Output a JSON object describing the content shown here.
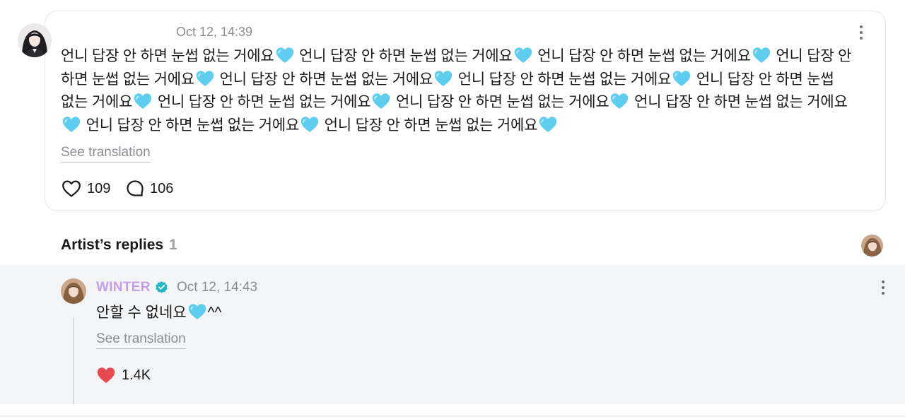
{
  "post": {
    "author_avatar_icon": "fan-avatar",
    "timestamp": "Oct 12, 14:39",
    "segments": [
      "언니 답장 안 하면 눈썹 없는 거에요",
      " 언니 답장 안 하면 눈썹 없는 거에요",
      " 언니 답장 안 하면 눈썹 없는 거에요",
      " 언니 답장 안 하면 눈썹 없는 거에요",
      " 언니 답장 안 하면 눈썹 없는 거에요",
      " 언니 답장 안 하면 눈썹 없는 거에요",
      " 언니 답장 안 하면 눈썹 없는 거에요",
      " 언니 답장 안 하면 눈썹 없는 거에요",
      " 언니 답장 안 하면 눈썹 없는 거에요",
      " 언니 답장 안 하면 눈썹 없는 거에요",
      " 언니 답장 안 하면 눈썹 없는 거에요",
      " 언니 답장 안 하면 눈썹 없는 거에요"
    ],
    "emoji_icon": "light-blue-heart-icon",
    "see_translation": "See translation",
    "like_count": "109",
    "comment_count": "106",
    "more_icon": "more-vertical-icon"
  },
  "artist_replies": {
    "title": "Artist’s replies",
    "count": "1",
    "reply": {
      "author": "WINTER",
      "verified_icon": "verified-badge-icon",
      "timestamp": "Oct 12, 14:43",
      "text_before_emoji": "안할 수 없네요",
      "text_after_emoji": "^^",
      "see_translation": "See translation",
      "like_count": "1.4K",
      "more_icon": "more-vertical-icon"
    }
  },
  "colors": {
    "artist_name": "#c79ee8",
    "verified": "#1fb7c6",
    "liked_heart": "#e8484f",
    "emoji_heart": "#5fcdf0"
  }
}
